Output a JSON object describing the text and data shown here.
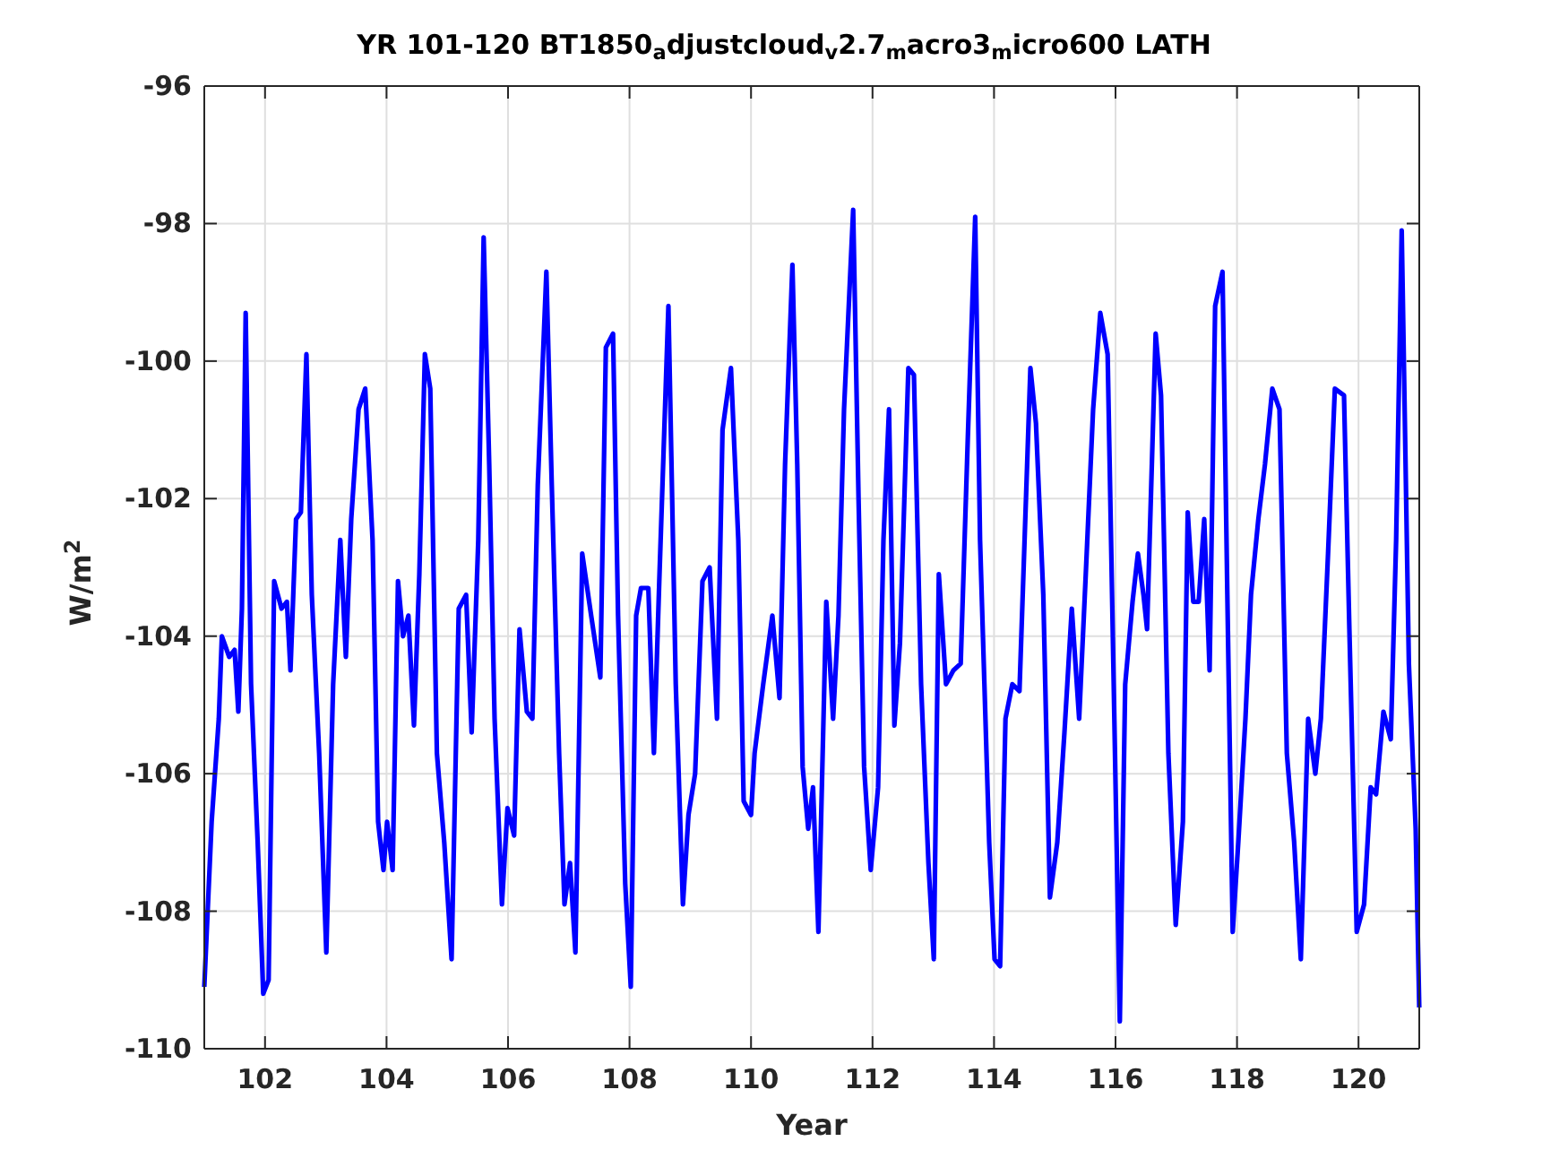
{
  "figure": {
    "chart_data": {
      "type": "line",
      "title": "YR 101-120 BT1850$_{a}$djustcloud$_{v}$2.7$_{m}$acro3$_{m}$icro600 LATH",
      "xlabel": "Year",
      "ylabel": "W/m$^{2}$",
      "grid": true,
      "xlim": [
        101,
        121
      ],
      "ylim": [
        -110,
        -96
      ],
      "xticks": [
        102,
        104,
        106,
        108,
        110,
        112,
        114,
        116,
        118,
        120
      ],
      "yticks": [
        -110,
        -108,
        -106,
        -104,
        -102,
        -100,
        -98,
        -96
      ],
      "x": [
        101.0,
        101.12,
        101.24,
        101.29,
        101.41,
        101.5,
        101.56,
        101.62,
        101.68,
        101.77,
        101.88,
        101.97,
        102.06,
        102.15,
        102.27,
        102.36,
        102.42,
        102.51,
        102.59,
        102.68,
        102.77,
        102.89,
        103.01,
        103.12,
        103.24,
        103.33,
        103.42,
        103.54,
        103.65,
        103.77,
        103.86,
        103.95,
        104.01,
        104.1,
        104.19,
        104.27,
        104.36,
        104.45,
        104.54,
        104.63,
        104.72,
        104.83,
        104.95,
        105.07,
        105.19,
        105.31,
        105.4,
        105.51,
        105.6,
        105.69,
        105.78,
        105.9,
        105.99,
        106.1,
        106.19,
        106.31,
        106.4,
        106.49,
        106.63,
        106.72,
        106.84,
        106.93,
        107.02,
        107.11,
        107.22,
        107.37,
        107.52,
        107.61,
        107.73,
        107.81,
        107.93,
        108.02,
        108.11,
        108.19,
        108.31,
        108.4,
        108.49,
        108.64,
        108.76,
        108.88,
        108.97,
        109.08,
        109.2,
        109.32,
        109.44,
        109.53,
        109.67,
        109.79,
        109.88,
        110.0,
        110.06,
        110.2,
        110.35,
        110.47,
        110.56,
        110.68,
        110.76,
        110.85,
        110.94,
        111.02,
        111.11,
        111.24,
        111.35,
        111.44,
        111.53,
        111.68,
        111.77,
        111.86,
        111.97,
        112.09,
        112.18,
        112.27,
        112.36,
        112.45,
        112.59,
        112.68,
        112.8,
        112.92,
        113.01,
        113.09,
        113.21,
        113.33,
        113.45,
        113.57,
        113.69,
        113.77,
        113.92,
        114.01,
        114.1,
        114.19,
        114.3,
        114.42,
        114.6,
        114.69,
        114.81,
        114.92,
        115.04,
        115.16,
        115.28,
        115.4,
        115.51,
        115.63,
        115.75,
        115.87,
        115.99,
        116.07,
        116.16,
        116.28,
        116.37,
        116.46,
        116.52,
        116.66,
        116.75,
        116.87,
        116.99,
        117.11,
        117.19,
        117.28,
        117.37,
        117.46,
        117.55,
        117.64,
        117.76,
        117.84,
        117.93,
        118.02,
        118.14,
        118.23,
        118.35,
        118.46,
        118.58,
        118.7,
        118.82,
        118.94,
        119.05,
        119.17,
        119.29,
        119.38,
        119.5,
        119.61,
        119.76,
        119.85,
        119.97,
        120.09,
        120.2,
        120.29,
        120.41,
        120.53,
        120.62,
        120.71,
        120.83,
        120.94,
        121.0
      ],
      "series": [
        {
          "color": "#0000ff",
          "values": [
            -109.1,
            -106.7,
            -105.2,
            -104.0,
            -104.3,
            -104.2,
            -105.1,
            -103.6,
            -99.3,
            -104.7,
            -107.0,
            -109.2,
            -109.0,
            -103.2,
            -103.6,
            -103.5,
            -104.5,
            -102.3,
            -102.2,
            -99.9,
            -103.4,
            -105.7,
            -108.6,
            -104.7,
            -102.6,
            -104.3,
            -102.3,
            -100.7,
            -100.4,
            -102.6,
            -106.7,
            -107.4,
            -106.7,
            -107.4,
            -103.2,
            -104.0,
            -103.7,
            -105.3,
            -103.1,
            -99.9,
            -100.4,
            -105.7,
            -107.0,
            -108.7,
            -103.6,
            -103.4,
            -105.4,
            -102.6,
            -98.2,
            -101.5,
            -105.2,
            -107.9,
            -106.5,
            -106.9,
            -103.9,
            -105.1,
            -105.2,
            -101.8,
            -98.7,
            -101.8,
            -105.7,
            -107.9,
            -107.3,
            -108.6,
            -102.8,
            -103.7,
            -104.6,
            -99.8,
            -99.6,
            -103.7,
            -107.6,
            -109.1,
            -103.7,
            -103.3,
            -103.3,
            -105.7,
            -103.2,
            -99.2,
            -104.7,
            -107.9,
            -106.6,
            -106.0,
            -103.2,
            -103.0,
            -105.2,
            -101.0,
            -100.1,
            -102.6,
            -106.4,
            -106.6,
            -105.7,
            -104.7,
            -103.7,
            -104.9,
            -101.5,
            -98.6,
            -101.5,
            -105.9,
            -106.8,
            -106.2,
            -108.3,
            -103.5,
            -105.2,
            -103.7,
            -100.7,
            -97.8,
            -102.0,
            -105.9,
            -107.4,
            -106.2,
            -102.6,
            -100.7,
            -105.3,
            -104.1,
            -100.1,
            -100.2,
            -104.7,
            -107.3,
            -108.7,
            -103.1,
            -104.7,
            -104.5,
            -104.4,
            -101.1,
            -97.9,
            -102.6,
            -107.0,
            -108.7,
            -108.8,
            -105.2,
            -104.7,
            -104.8,
            -100.1,
            -100.9,
            -103.4,
            -107.8,
            -107.0,
            -105.4,
            -103.6,
            -105.2,
            -103.1,
            -100.7,
            -99.3,
            -99.9,
            -105.7,
            -109.6,
            -104.7,
            -103.5,
            -102.8,
            -103.4,
            -103.9,
            -99.6,
            -100.5,
            -105.7,
            -108.2,
            -106.7,
            -102.2,
            -103.5,
            -103.5,
            -102.3,
            -104.5,
            -99.2,
            -98.7,
            -103.4,
            -108.3,
            -107.0,
            -105.2,
            -103.4,
            -102.3,
            -101.5,
            -100.4,
            -100.7,
            -105.7,
            -107.0,
            -108.7,
            -105.2,
            -106.0,
            -105.2,
            -102.8,
            -100.4,
            -100.5,
            -103.9,
            -108.3,
            -107.9,
            -106.2,
            -106.3,
            -105.1,
            -105.5,
            -102.6,
            -98.1,
            -104.4,
            -106.8,
            -109.4
          ]
        }
      ]
    }
  }
}
